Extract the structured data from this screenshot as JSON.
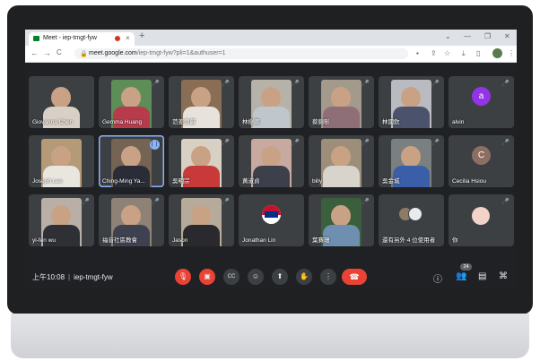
{
  "browser": {
    "tab_title": "Meet - iep-tmgt-fyw",
    "new_tab": "+",
    "close_tab": "×",
    "url_host": "meet.google.com",
    "url_path": "/iep-tmgt-fyw?pli=1&authuser=1",
    "win_min": "—",
    "win_restore": "❐",
    "win_close": "✕",
    "back": "←",
    "forward": "→",
    "reload": "C",
    "chevron": "⌄"
  },
  "participants": [
    {
      "name": "Giovanna Chen",
      "muted": false,
      "bg": "#3c4043",
      "shirt": "#d9d0c5"
    },
    {
      "name": "Gemma Huang",
      "muted": true,
      "bg": "#5f8d57",
      "shirt": "#b83b4c"
    },
    {
      "name": "范姜創蔚",
      "muted": true,
      "bg": "#8a6d55",
      "shirt": "#e7e3dc"
    },
    {
      "name": "林樹卿",
      "muted": true,
      "bg": "#b7b2a8",
      "shirt": "#bfc6cc"
    },
    {
      "name": "蔡錦彰",
      "muted": true,
      "bg": "#a49a8c",
      "shirt": "#8f6f77"
    },
    {
      "name": "林國欽",
      "muted": true,
      "bg": "#b9bbc0",
      "shirt": "#4a536b"
    },
    {
      "name": "alvin",
      "muted": true,
      "avatar_letter": "a",
      "avatar_color": "#9334e6"
    },
    {
      "name": "Joseph Lee",
      "muted": false,
      "bg": "#b49a76",
      "shirt": "#e9e6e0"
    },
    {
      "name": "Ching-Ming Ya...",
      "muted": false,
      "speaking": true,
      "bg": "#756353",
      "shirt": "#2a2d38"
    },
    {
      "name": "吳明宗",
      "muted": true,
      "bg": "#d9d0c4",
      "shirt": "#c83a3a"
    },
    {
      "name": "黃淑貞",
      "muted": true,
      "bg": "#c7a9a0",
      "shirt": "#3d3f4a"
    },
    {
      "name": "billy",
      "muted": true,
      "bg": "#9c8e78",
      "shirt": "#d8d3cb"
    },
    {
      "name": "吳金城",
      "muted": true,
      "bg": "#7a7f7f",
      "shirt": "#3a5fa8"
    },
    {
      "name": "Cecilia Hsiou",
      "muted": true,
      "avatar_letter": "C",
      "avatar_color": "#8d6e63"
    },
    {
      "name": "yi-fen wu",
      "muted": true,
      "bg": "#b8b0a7",
      "shirt": "#2f2f36"
    },
    {
      "name": "福音社區教會",
      "muted": true,
      "bg": "#8d8275",
      "shirt": "#3e4150"
    },
    {
      "name": "Jason",
      "muted": true,
      "bg": "#b6aa9b",
      "shirt": "#2a2a2e"
    },
    {
      "name": "Jonathan Lin",
      "muted": false,
      "flag": true
    },
    {
      "name": "葉賽珊",
      "muted": true,
      "bg": "#3b5f3c",
      "shirt": "#6f8fb0"
    },
    {
      "name": "還有另外 4 位使用者",
      "muted": false,
      "others": true
    },
    {
      "name": "你",
      "muted": true,
      "self": true
    }
  ],
  "bottom": {
    "time": "上午10:08",
    "separator": "|",
    "meeting_code": "iep-tmgt-fyw",
    "people_count": "24"
  },
  "icons": {
    "mic_off": "mic-off-icon",
    "cam_off": "videocam-off-icon",
    "captions": "closed-captions-icon",
    "emoji": "emoji-icon",
    "present": "present-screen-icon",
    "hand": "raise-hand-icon",
    "more": "more-vert-icon",
    "end": "call-end-icon",
    "info": "info-icon",
    "people": "people-icon",
    "chat": "chat-icon",
    "activities": "activities-icon"
  },
  "colors": {
    "meet_bg": "#202124",
    "tile_bg": "#3c4043",
    "danger": "#ea4335",
    "speaking": "#8ab4f8"
  }
}
